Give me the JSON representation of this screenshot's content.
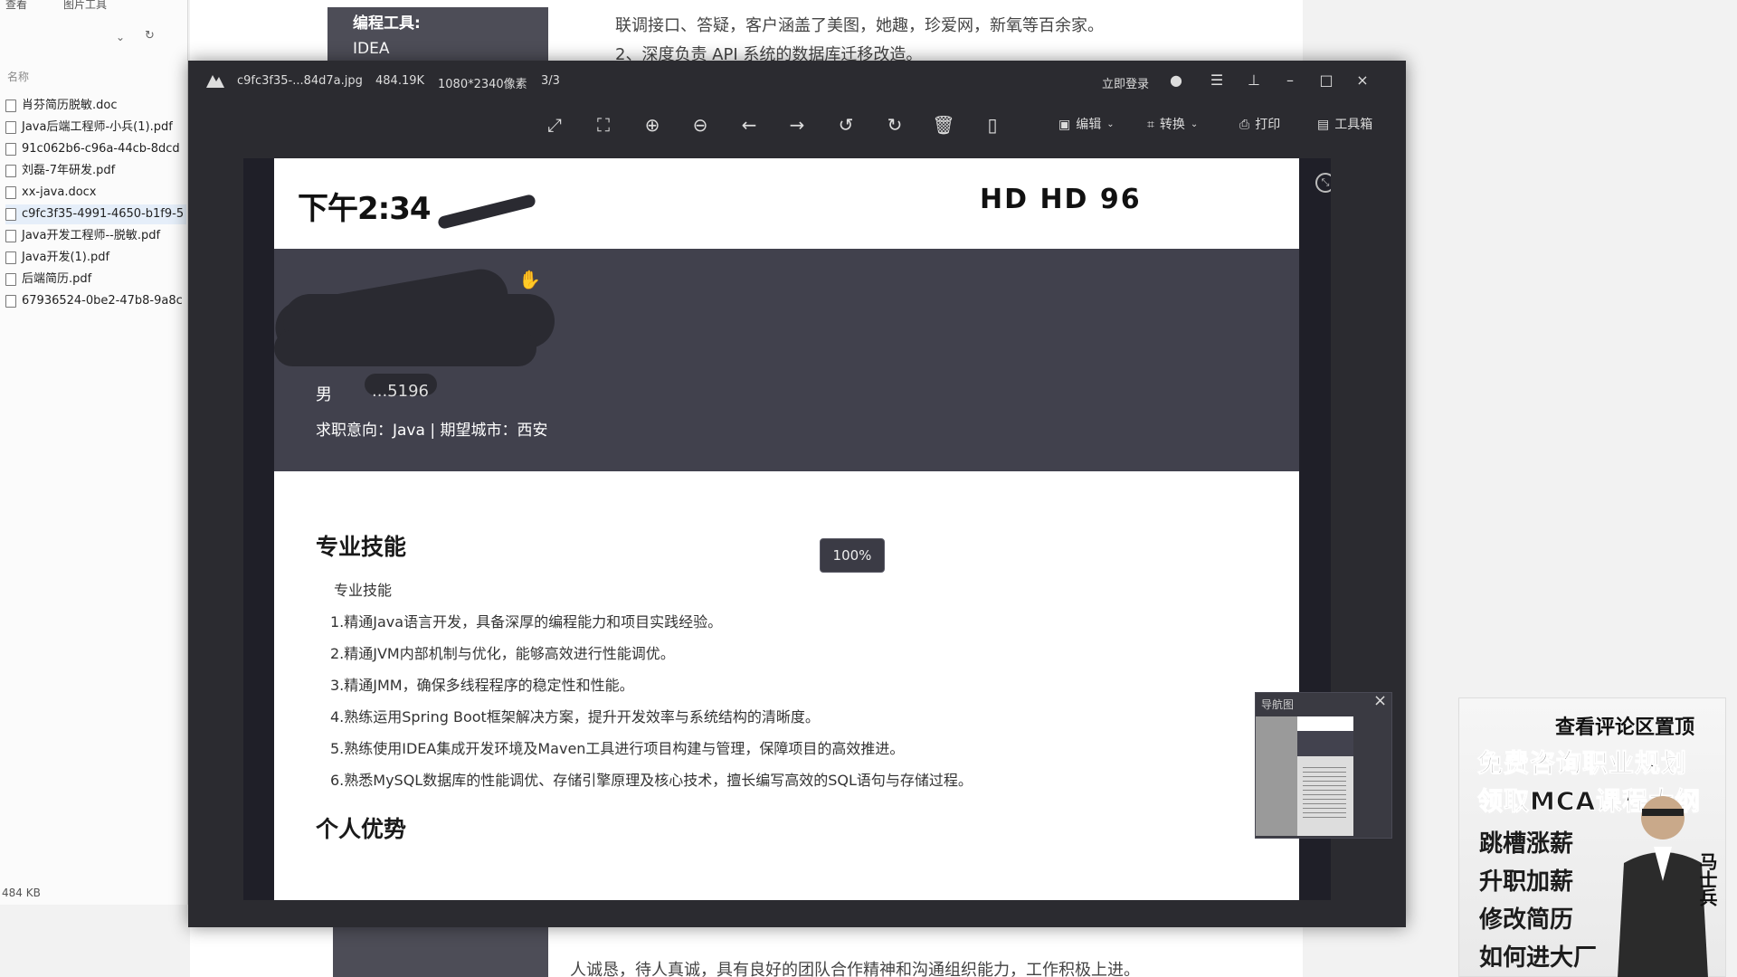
{
  "explorer": {
    "ribbon": [
      "查看",
      "图片工具"
    ],
    "column_header": "名称",
    "files": [
      "肖芬简历脱敏.doc",
      "Java后端工程师-小兵(1).pdf",
      "91c062b6-c96a-44cb-8dcd",
      "刘磊-7年研发.pdf",
      "xx-java.docx",
      "c9fc3f35-4991-4650-b1f9-5",
      "Java开发工程师--脱敏.pdf",
      "Java开发(1).pdf",
      "后端简历.pdf",
      "67936524-0be2-47b8-9a8c"
    ],
    "selected_index": 5,
    "size": "484 KB"
  },
  "background_doc": {
    "side_title": "编程工具:",
    "side_value": "IDEA",
    "line1": "联调接口、答疑，客户涵盖了美图，她趣，珍爱网，新氧等百余家。",
    "line2": "2、深度负责 API 系统的数据库迁移改造。",
    "line3": "人诚恳，待人真诚，具有良好的团队合作精神和沟通组织能力，工作积极上进。"
  },
  "viewer": {
    "filename": "c9fc3f35-...84d7a.jpg",
    "filesize": "484.19K",
    "dimensions": "1080*2340像素",
    "page": "3/3",
    "login": "立即登录",
    "toolbar": {
      "edit": "编辑",
      "convert": "转换",
      "print": "打印",
      "toolbox": "工具箱"
    },
    "zoom": "100%",
    "navigator_label": "导航图"
  },
  "resume": {
    "status_time": "下午2:34",
    "status_icons": "HD HD 96",
    "gender": "男",
    "phone_fragment": "...5196",
    "intent": "求职意向：Java | 期望城市：西安",
    "skills_title": "专业技能",
    "skills_sub": "专业技能",
    "skills": [
      "1.精通Java语言开发，具备深厚的编程能力和项目实践经验。",
      "2.精通JVM内部机制与优化，能够高效进行性能调优。",
      "3.精通JMM，确保多线程程序的稳定性和性能。",
      "4.熟练运用Spring Boot框架解决方案，提升开发效率与系统结构的清晰度。",
      "5.熟练使用IDEA集成开发环境及Maven工具进行项目构建与管理，保障项目的高效推进。",
      "6.熟悉MySQL数据库的性能调优、存储引擎原理及核心技术，擅长编写高效的SQL语句与存储过程。"
    ],
    "advantage_title": "个人优势"
  },
  "promo": {
    "header": "查看评论区置顶",
    "line1": "免费咨询职业规划",
    "line2": "领取MCA课程大纲",
    "items": [
      "跳槽涨薪",
      "升职加薪",
      "修改简历",
      "如何进大厂"
    ],
    "brand": "马士兵"
  }
}
